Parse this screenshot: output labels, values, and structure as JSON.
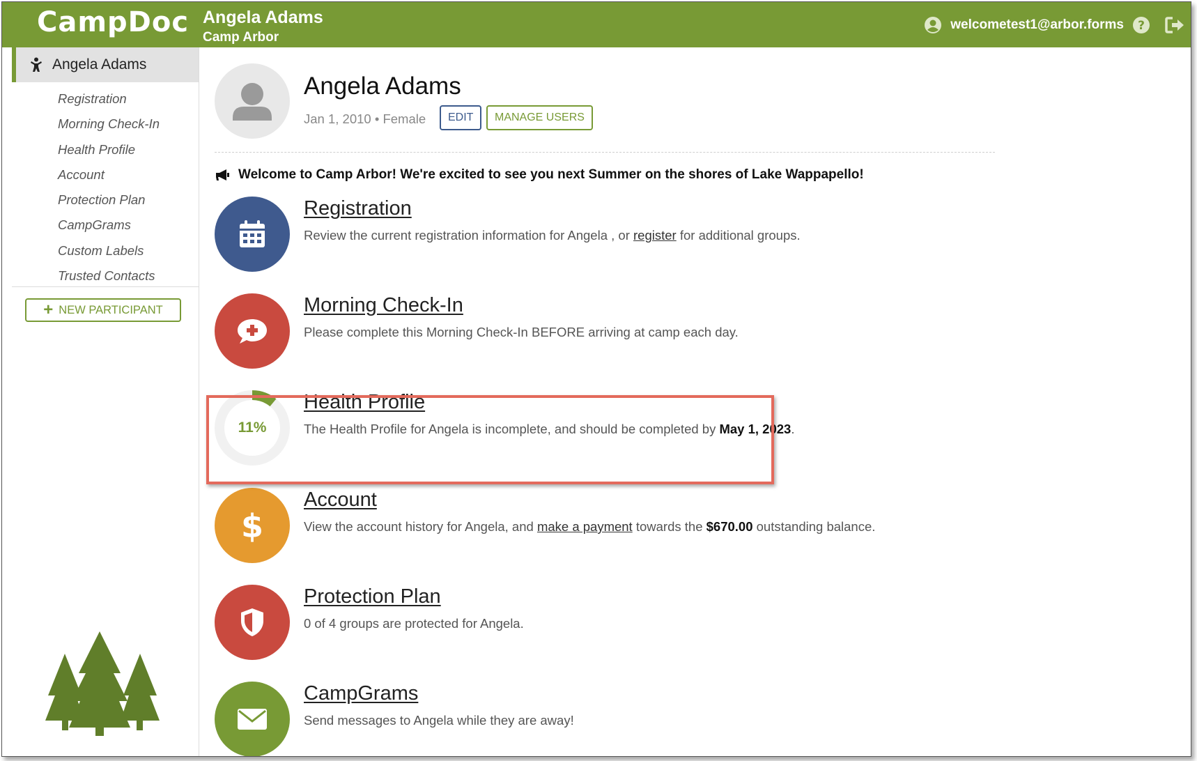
{
  "app": {
    "logo": "CampDoc"
  },
  "topbar": {
    "participant_name": "Angela Adams",
    "camp_name": "Camp Arbor",
    "user_email": "welcometest1@arbor.forms"
  },
  "sidebar": {
    "participant": "Angela Adams",
    "items": [
      {
        "label": "Registration"
      },
      {
        "label": "Morning Check-In"
      },
      {
        "label": "Health Profile"
      },
      {
        "label": "Account"
      },
      {
        "label": "Protection Plan"
      },
      {
        "label": "CampGrams"
      },
      {
        "label": "Custom Labels"
      },
      {
        "label": "Trusted Contacts"
      }
    ],
    "new_participant": "NEW PARTICIPANT"
  },
  "profile": {
    "name": "Angela Adams",
    "meta": "Jan 1, 2010 • Female",
    "edit_label": "EDIT",
    "manage_users_label": "MANAGE USERS"
  },
  "welcome": "Welcome to Camp Arbor! We're excited to see you next Summer on the shores of Lake Wappapello!",
  "sections": {
    "registration": {
      "title": "Registration",
      "desc_pre": "Review the current registration information for Angela , or ",
      "desc_link": "register",
      "desc_post": " for additional groups.",
      "color": "#3f5a8e"
    },
    "checkin": {
      "title": "Morning Check-In",
      "desc": "Please complete this Morning Check-In BEFORE arriving at camp each day.",
      "color": "#c94a3f"
    },
    "health": {
      "title": "Health Profile",
      "progress_label": "11%",
      "progress": 0.11,
      "desc_pre": "The Health Profile for Angela is incomplete, and should be completed by ",
      "desc_bold": "May 1, 2023",
      "desc_post": "."
    },
    "account": {
      "title": "Account",
      "desc_pre": "View the account history for Angela, and ",
      "desc_link": "make a payment",
      "desc_mid": " towards the ",
      "desc_bold": "$670.00",
      "desc_post": " outstanding balance.",
      "color": "#e59a2f"
    },
    "protection": {
      "title": "Protection Plan",
      "desc": "0 of 4 groups are protected for Angela.",
      "color": "#c94a3f"
    },
    "campgrams": {
      "title": "CampGrams",
      "desc": "Send messages to Angela while they are away!",
      "color": "#789a35"
    }
  },
  "colors": {
    "brand": "#789a35",
    "highlight": "#e36a5c"
  }
}
